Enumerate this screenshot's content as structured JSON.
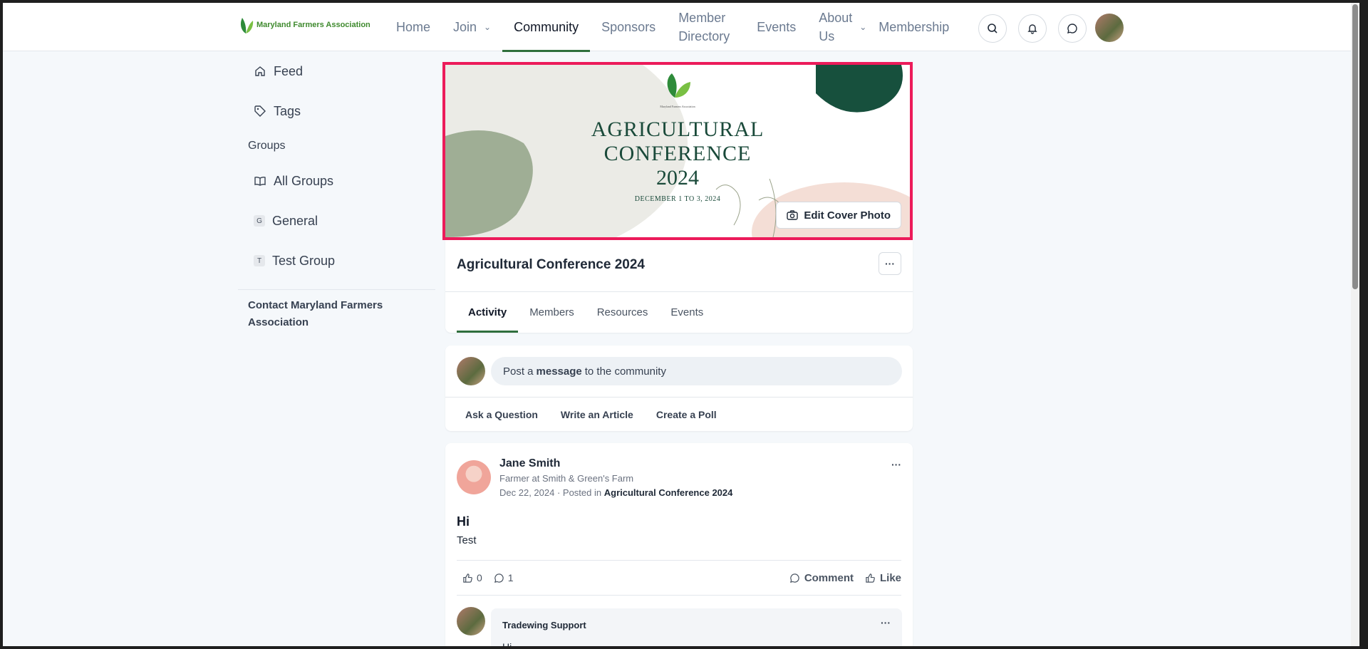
{
  "header": {
    "logo_text": "Maryland Farmers Association",
    "nav": [
      {
        "label": "Home"
      },
      {
        "label": "Join"
      },
      {
        "label": "Community"
      },
      {
        "label": "Sponsors"
      },
      {
        "label": "Member Directory"
      },
      {
        "label": "Events"
      },
      {
        "label": "About Us"
      },
      {
        "label": "Membership"
      }
    ]
  },
  "sidebar": {
    "feed": "Feed",
    "tags": "Tags",
    "groups_heading": "Groups",
    "all_groups": "All Groups",
    "general": {
      "letter": "G",
      "label": "General"
    },
    "test_group": {
      "letter": "T",
      "label": "Test Group"
    },
    "contact": "Contact Maryland Farmers Association"
  },
  "cover": {
    "title_line1": "AGRICULTURAL",
    "title_line2": "CONFERENCE",
    "title_line3": "2024",
    "dates": "DECEMBER 1 TO 3, 2024",
    "logo_caption": "Maryland Farmers Association",
    "edit_label": "Edit Cover Photo"
  },
  "group": {
    "title": "Agricultural Conference 2024",
    "more": "···",
    "tabs": [
      "Activity",
      "Members",
      "Resources",
      "Events"
    ]
  },
  "composer": {
    "prefix": "Post a",
    "bold": "message",
    "suffix": "to the community",
    "actions": [
      "Ask a Question",
      "Write an Article",
      "Create a Poll"
    ]
  },
  "post": {
    "author": "Jane Smith",
    "subtitle": "Farmer at Smith & Green's Farm",
    "date": "Dec 22, 2024",
    "posted_in_prefix": "· Posted in",
    "posted_in_group": "Agricultural Conference 2024",
    "title": "Hi",
    "body": "Test",
    "likes": "0",
    "comments": "1",
    "comment_label": "Comment",
    "like_label": "Like",
    "more": "···",
    "reply": {
      "author": "Tradewing Support",
      "text": "Hi",
      "more": "···"
    }
  },
  "colors": {
    "accent_green": "#2f6f3c",
    "highlight_border": "#ec1b5a",
    "page_bg": "#f5f8fb"
  }
}
